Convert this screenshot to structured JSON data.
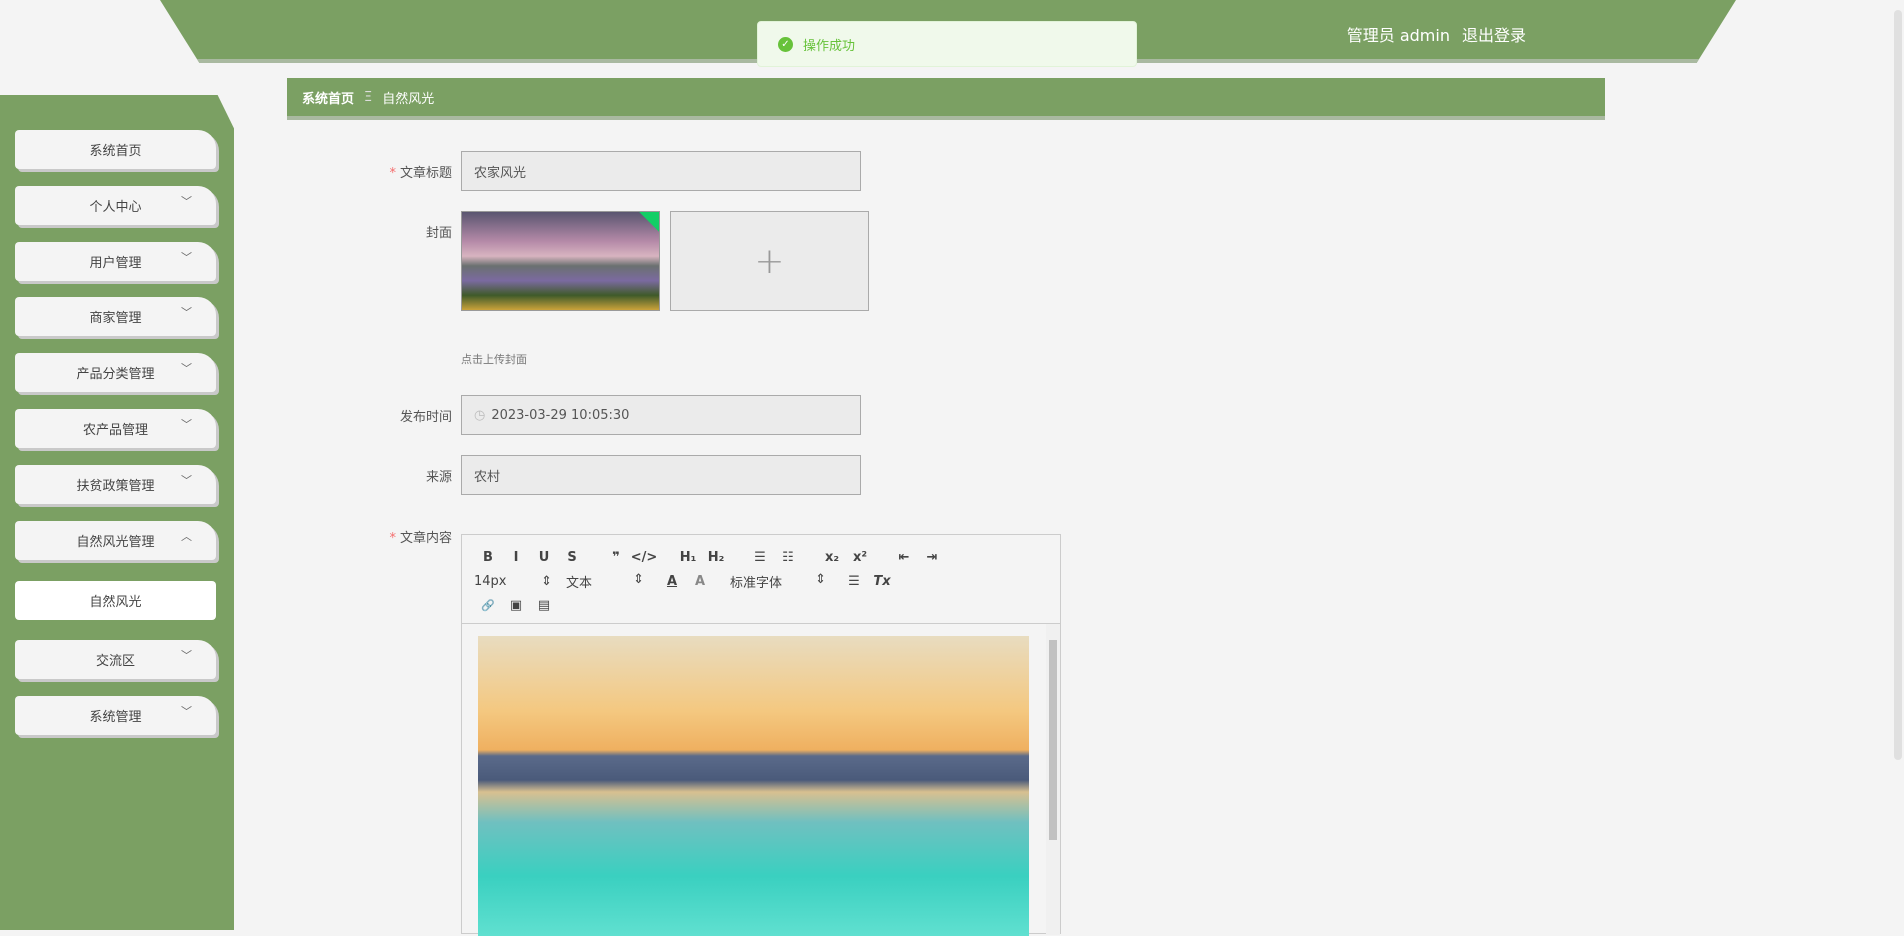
{
  "header": {
    "title": "基",
    "user_label": "管理员 admin",
    "logout": "退出登录"
  },
  "toast": {
    "message": "操作成功"
  },
  "breadcrumb": {
    "home": "系统首页",
    "separator": "Ξ",
    "current": "自然风光"
  },
  "sidebar": {
    "items": [
      {
        "label": "系统首页",
        "chevron": ""
      },
      {
        "label": "个人中心",
        "chevron": "﹀"
      },
      {
        "label": "用户管理",
        "chevron": "﹀"
      },
      {
        "label": "商家管理",
        "chevron": "﹀"
      },
      {
        "label": "产品分类管理",
        "chevron": "﹀"
      },
      {
        "label": "农产品管理",
        "chevron": "﹀"
      },
      {
        "label": "扶贫政策管理",
        "chevron": "﹀"
      },
      {
        "label": "自然风光管理",
        "chevron": "︿"
      },
      {
        "label": "自然风光",
        "chevron": ""
      },
      {
        "label": "交流区",
        "chevron": "﹀"
      },
      {
        "label": "系统管理",
        "chevron": "﹀"
      }
    ]
  },
  "form": {
    "title_label": "文章标题",
    "title_value": "农家风光",
    "cover_label": "封面",
    "cover_hint": "点击上传封面",
    "plus": "+",
    "time_label": "发布时间",
    "time_value": "2023-03-29 10:05:30",
    "source_label": "来源",
    "source_value": "农村",
    "content_label": "文章内容",
    "required": "*"
  },
  "editor": {
    "buttons": [
      "B",
      "I",
      "U",
      "S",
      "❞",
      "</>",
      "H₁",
      "H₂",
      "☰",
      "☷",
      "x₂",
      "x²",
      "⇤",
      "⇥"
    ],
    "size": "14px",
    "header": "文本",
    "font": "标准字体",
    "color": "A",
    "bg": "A",
    "align": "☰",
    "clean": "Tx",
    "link": "🔗",
    "image": "▣",
    "video": "▤"
  }
}
